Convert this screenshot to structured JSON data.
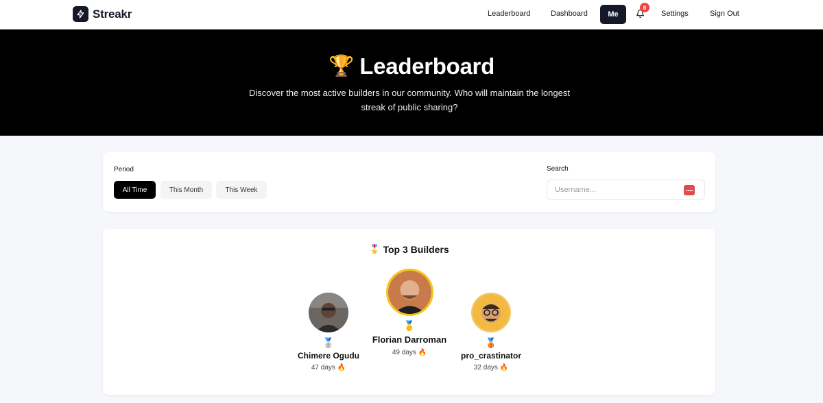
{
  "brand": {
    "name": "Streakr"
  },
  "nav": {
    "leaderboard": "Leaderboard",
    "dashboard": "Dashboard",
    "me": "Me",
    "notifications_count": "8",
    "settings": "Settings",
    "sign_out": "Sign Out"
  },
  "hero": {
    "trophy": "🏆",
    "title": "Leaderboard",
    "subtitle": "Discover the most active builders in our community. Who will maintain the longest streak of public sharing?"
  },
  "filters": {
    "period_label": "Period",
    "periods": [
      "All Time",
      "This Month",
      "This Week"
    ],
    "active_period": "All Time",
    "search_label": "Search",
    "search_placeholder": "Username..."
  },
  "top3": {
    "title_icon": "🎖️",
    "title": "Top 3 Builders",
    "builders": [
      {
        "rank": 2,
        "medal": "🥈",
        "name": "Chimere Ogudu",
        "days": "47 days 🔥"
      },
      {
        "rank": 1,
        "medal": "🥇",
        "name": "Florian Darroman",
        "days": "49 days 🔥"
      },
      {
        "rank": 3,
        "medal": "🥉",
        "name": "pro_crastinator",
        "days": "32 days 🔥"
      }
    ]
  },
  "colors": {
    "brand_dark": "#151829",
    "hero_bg": "#000000",
    "badge_red": "#ef4444",
    "gold_ring": "#f5c518"
  }
}
